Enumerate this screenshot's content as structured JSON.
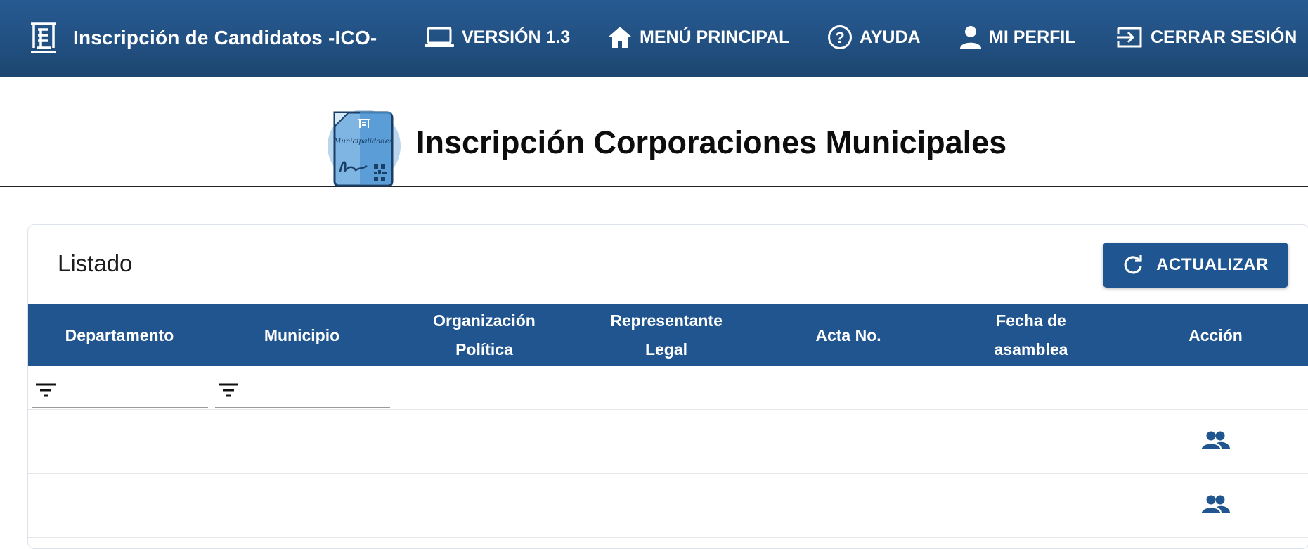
{
  "app": {
    "title": "Inscripción de Candidatos -ICO-"
  },
  "nav": {
    "version": "VERSIÓN 1.3",
    "menu": "MENÚ PRINCIPAL",
    "help": "AYUDA",
    "profile": "MI PERFIL",
    "logout": "CERRAR SESIÓN"
  },
  "page": {
    "title": "Inscripción Corporaciones Municipales",
    "doc_icon_text": "Municipalidades"
  },
  "card": {
    "title": "Listado",
    "refresh_label": "ACTUALIZAR"
  },
  "table": {
    "headers": [
      [
        "Departamento"
      ],
      [
        "Municipio"
      ],
      [
        "Organización",
        "Política"
      ],
      [
        "Representante",
        "Legal"
      ],
      [
        "Acta No."
      ],
      [
        "Fecha de",
        "asamblea"
      ],
      [
        "Acción"
      ]
    ],
    "rows": [
      {
        "departamento": "",
        "municipio": "",
        "organizacion": "",
        "representante": "",
        "acta": "",
        "fecha": "",
        "accion_icon": "group-icon"
      },
      {
        "departamento": "",
        "municipio": "",
        "organizacion": "",
        "representante": "",
        "acta": "",
        "fecha": "",
        "accion_icon": "group-icon"
      }
    ]
  },
  "colors": {
    "primary": "#21558f",
    "topbar": "#275a92"
  }
}
